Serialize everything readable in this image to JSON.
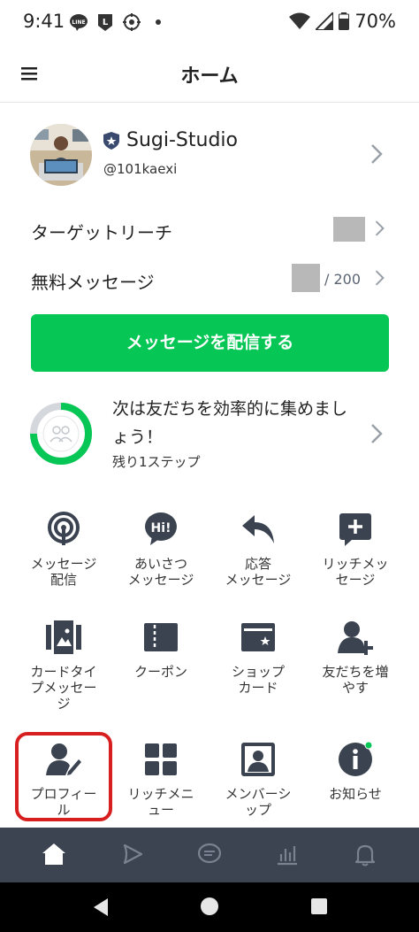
{
  "status_bar": {
    "time": "9:41",
    "battery": "70%",
    "notif_icons": [
      "line-icon",
      "l-app-icon",
      "target-icon",
      "dot-icon"
    ]
  },
  "header": {
    "title": "ホーム"
  },
  "account": {
    "name": "Sugi-Studio",
    "id": "@101kaexi"
  },
  "rows": {
    "target_reach_label": "ターゲットリーチ",
    "free_messages_label": "無料メッセージ",
    "free_messages_count": "/ 200"
  },
  "cta": {
    "label": "メッセージを配信する"
  },
  "steps": {
    "title": "次は友だちを効率的に集めましょう！",
    "subtitle": "残り1ステップ"
  },
  "grid": [
    {
      "label": "メッセージ\n配信",
      "icon": "broadcast-icon"
    },
    {
      "label": "あいさつ\nメッセージ",
      "icon": "greeting-icon"
    },
    {
      "label": "応答\nメッセージ",
      "icon": "reply-icon"
    },
    {
      "label": "リッチメッ\nセージ",
      "icon": "rich-message-icon"
    },
    {
      "label": "カードタイ\nプメッセー\nジ",
      "icon": "card-message-icon"
    },
    {
      "label": "クーポン",
      "icon": "coupon-icon"
    },
    {
      "label": "ショップ\nカード",
      "icon": "shop-card-icon"
    },
    {
      "label": "友だちを増\nやす",
      "icon": "add-friend-icon"
    },
    {
      "label": "プロフィー\nル",
      "icon": "profile-icon"
    },
    {
      "label": "リッチメニ\nュー",
      "icon": "rich-menu-icon"
    },
    {
      "label": "メンバーシ\nップ",
      "icon": "membership-icon"
    },
    {
      "label": "お知らせ",
      "icon": "info-icon"
    }
  ],
  "colors": {
    "accent": "#06c755",
    "highlight": "#d81f1f",
    "nav_bg": "#3d4451"
  }
}
